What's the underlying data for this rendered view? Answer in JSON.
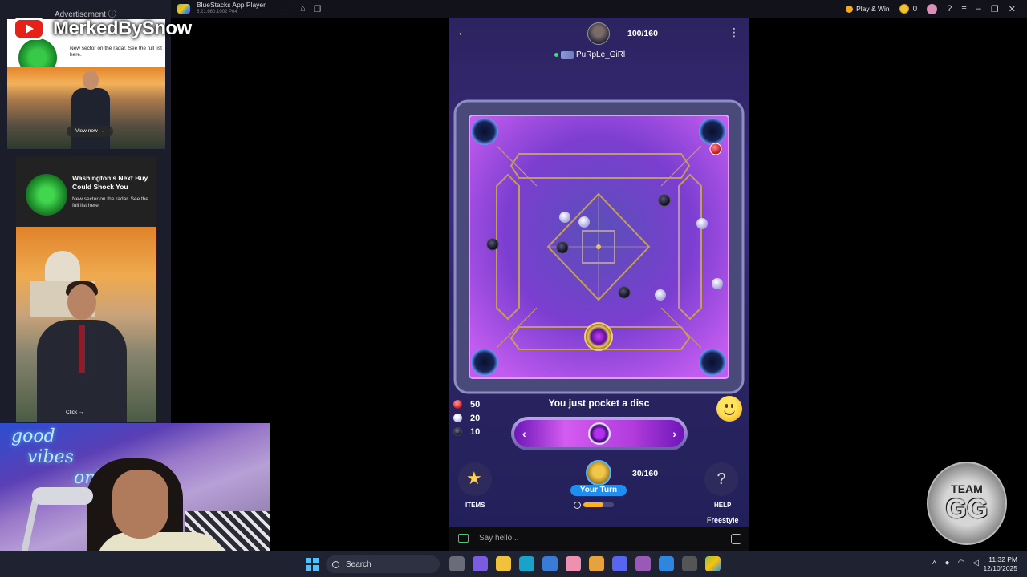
{
  "window": {
    "title": "BlueStacks App Player",
    "version": "5.21.660.1002  P64",
    "play_win_label": "Play & Win",
    "coins": "0"
  },
  "ads": {
    "header": "Advertisement ⓘ",
    "ad1_text": "New sector on the radar. See the full list here.",
    "ad1_cta": "View now →",
    "ad2_headline": "Washington's Next Buy Could Shock You",
    "ad2_text": "New sector on the radar. See the full list here.",
    "ad2_cta": "Click →"
  },
  "youtube": {
    "channel": "MerkedBySnow"
  },
  "game": {
    "opponent_score": "100/160",
    "opponent_name": "PuRpLe_GiRl",
    "message": "You just pocket a disc",
    "counters": [
      {
        "name": "red",
        "value": "50"
      },
      {
        "name": "white",
        "value": "20"
      },
      {
        "name": "black",
        "value": "10"
      }
    ],
    "items_label": "ITEMS",
    "help_label": "HELP",
    "help_icon": "?",
    "turn_label": "Your Turn",
    "player_score": "30/160",
    "timer_fraction": 0.65,
    "mode": "Freestyle",
    "chat_placeholder": "Say hello..."
  },
  "webcam": {
    "neon_line1": "good",
    "neon_line2": "vibes",
    "neon_line3": "only"
  },
  "overlay_logo": {
    "line1": "TEAM",
    "line2": "GG"
  },
  "taskbar": {
    "search_label": "Search",
    "time": "11:32 PM",
    "date": "12/10/2025"
  },
  "colors": {
    "accent_blue": "#1e8ff0",
    "board_purple": "#9b3fe0",
    "frame_gold": "#c9a84a"
  }
}
